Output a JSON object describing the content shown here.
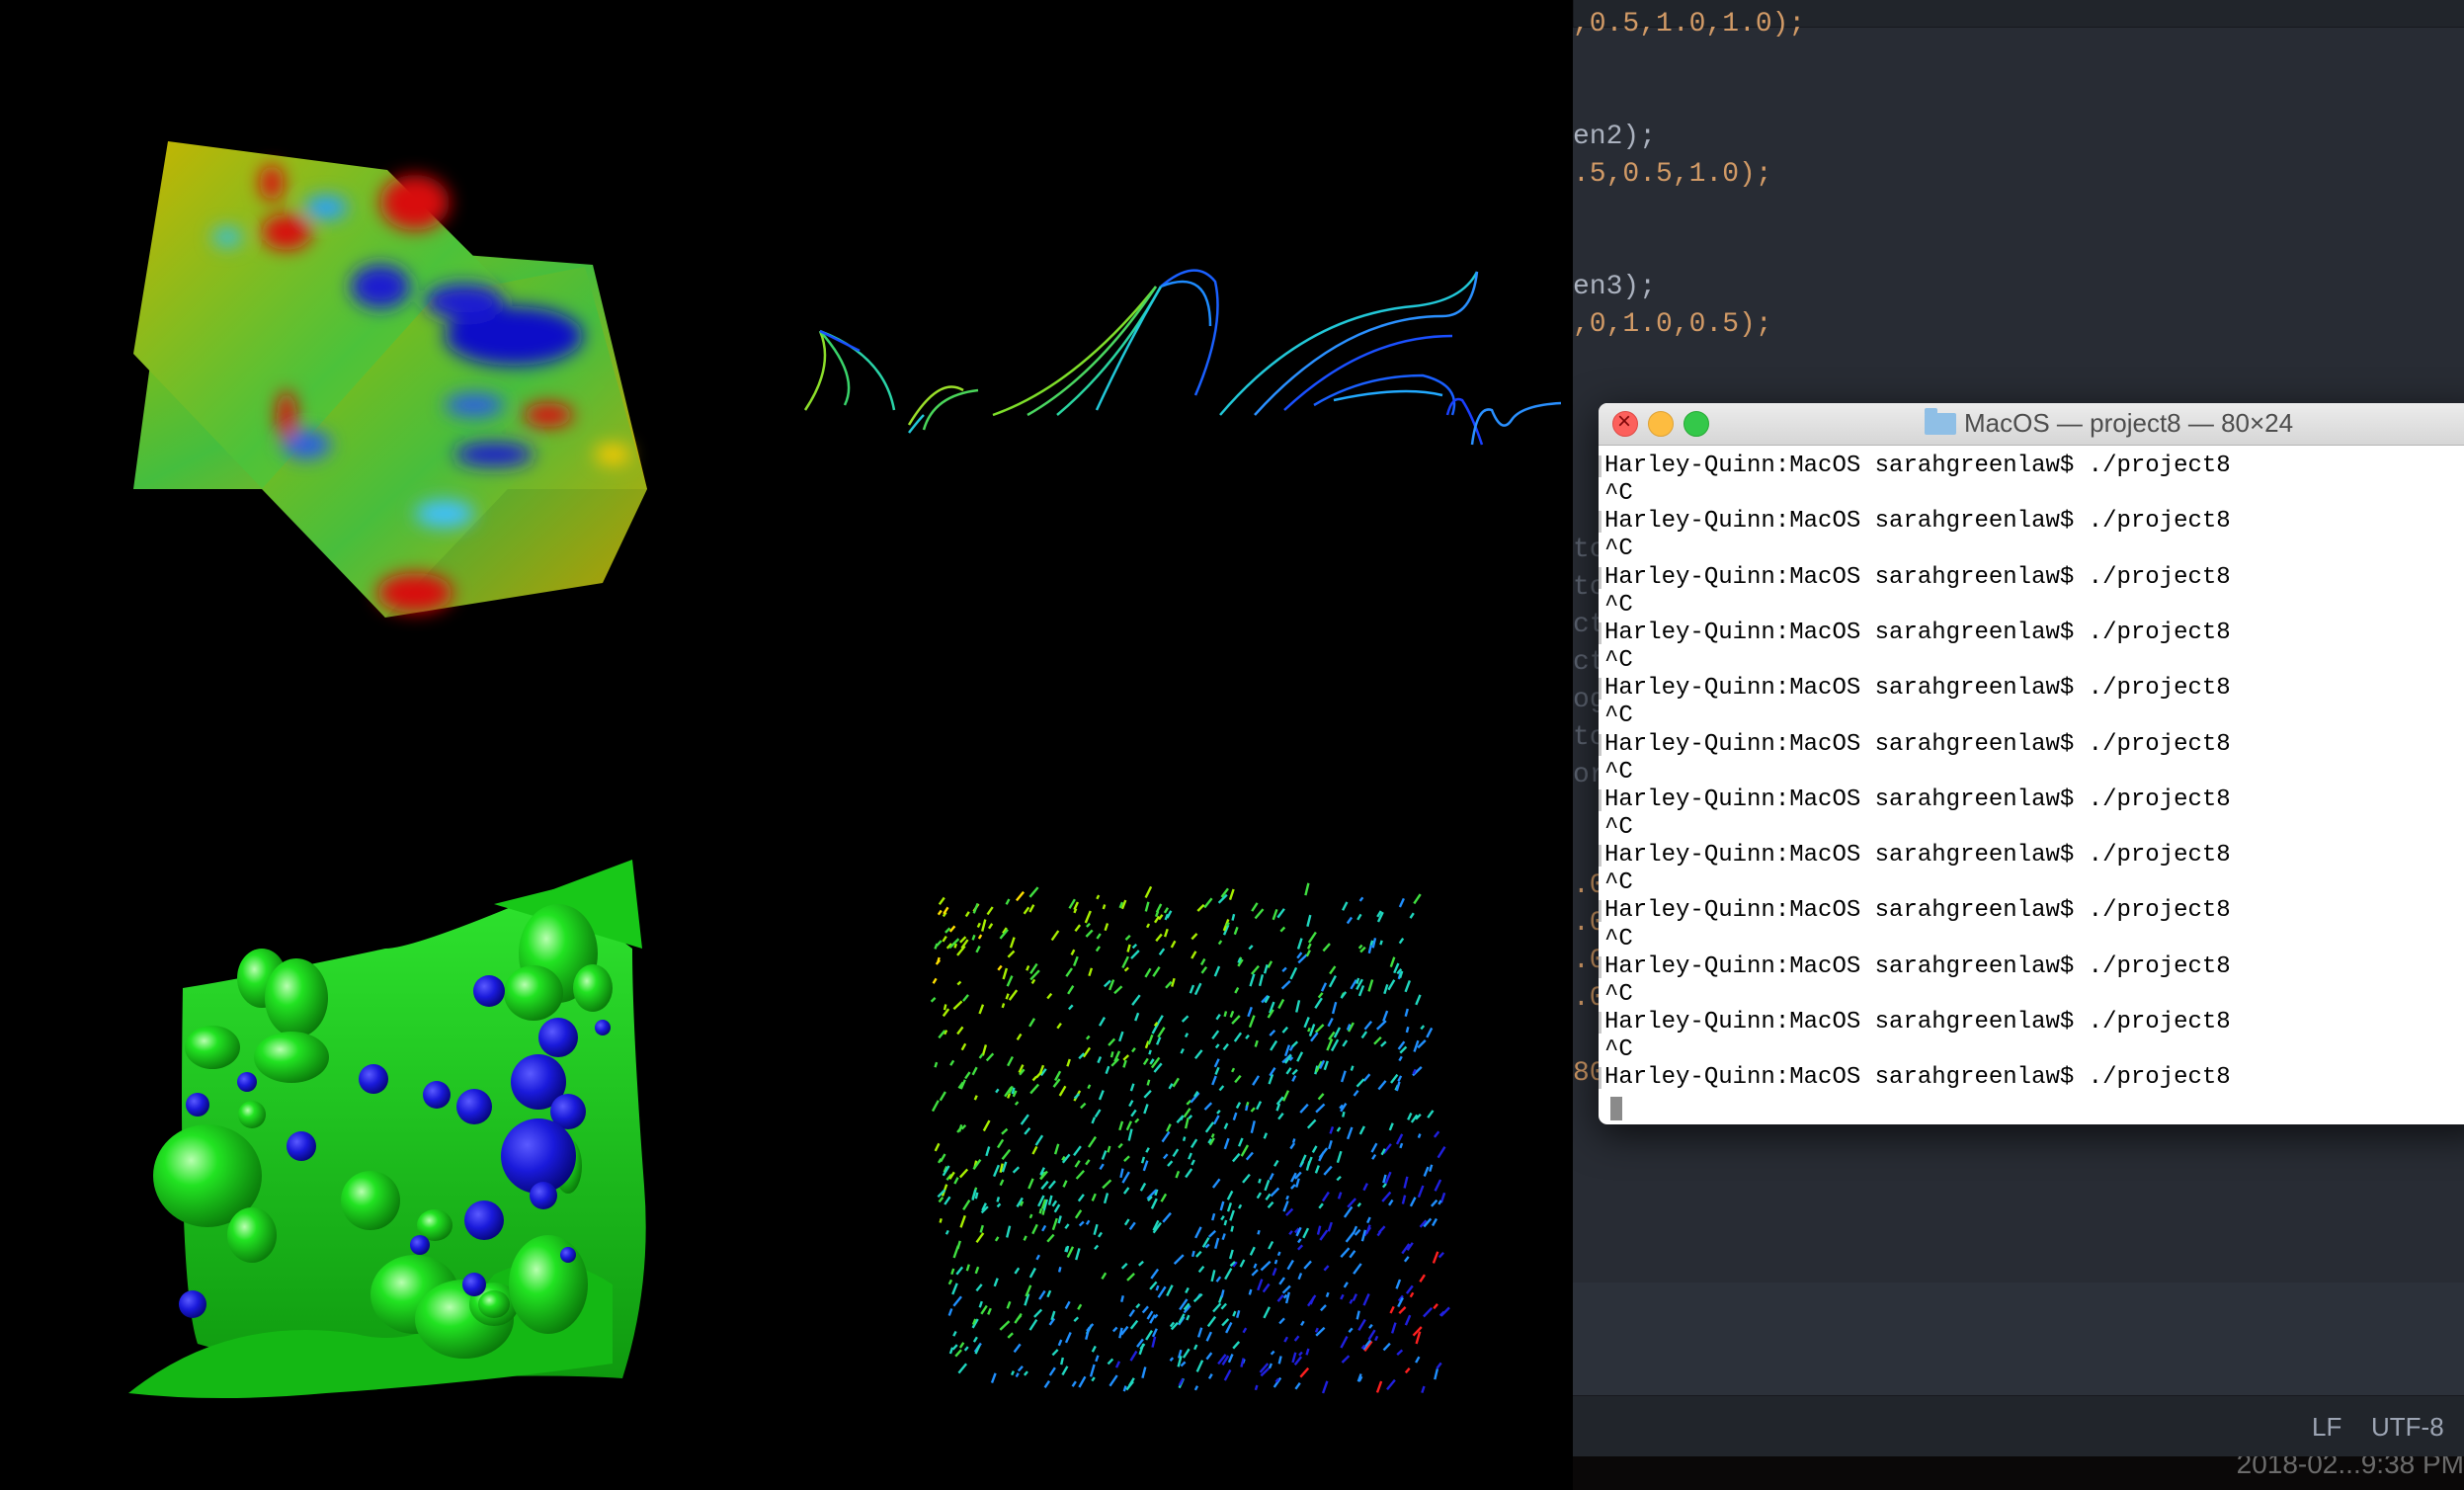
{
  "gl_window": {
    "panels": [
      "colored-surface-planes",
      "streamlines",
      "isosurface-blobs",
      "vector-glyph-field"
    ]
  },
  "editor": {
    "code_lines": [
      {
        "text": ",0.5,1.0,1.0);",
        "y": 0
      },
      {
        "text": "en2);",
        "y": 1
      },
      {
        "text": ".5,0.5,1.0);",
        "y": 2
      },
      {
        "text": "en3);",
        "y": 3
      },
      {
        "text": ",0,1.0,0.5);",
        "y": 4
      }
    ],
    "gutter_fragments": [
      "to",
      "to",
      "ct",
      "ct",
      "og",
      "to",
      "or",
      ".0",
      ".0",
      ".0",
      ".0",
      "80"
    ],
    "colors": {
      "background": "#282c34",
      "number": "#d19a66",
      "text": "#abb2bf"
    }
  },
  "statusbar": {
    "line_ending": "LF",
    "encoding": "UTF-8"
  },
  "menubar_clock": "2018-02...9:38 PM",
  "terminal": {
    "title": "MacOS — project8 — 80×24",
    "prompt": "Harley-Quinn:MacOS sarahgreenlaw$ ./project8",
    "interrupt": "^C",
    "lines": [
      "Harley-Quinn:MacOS sarahgreenlaw$ ./project8",
      "^C",
      "Harley-Quinn:MacOS sarahgreenlaw$ ./project8",
      "^C",
      "Harley-Quinn:MacOS sarahgreenlaw$ ./project8",
      "^C",
      "Harley-Quinn:MacOS sarahgreenlaw$ ./project8",
      "^C",
      "Harley-Quinn:MacOS sarahgreenlaw$ ./project8",
      "^C",
      "Harley-Quinn:MacOS sarahgreenlaw$ ./project8",
      "^C",
      "Harley-Quinn:MacOS sarahgreenlaw$ ./project8",
      "^C",
      "Harley-Quinn:MacOS sarahgreenlaw$ ./project8",
      "^C",
      "Harley-Quinn:MacOS sarahgreenlaw$ ./project8",
      "^C",
      "Harley-Quinn:MacOS sarahgreenlaw$ ./project8",
      "^C",
      "Harley-Quinn:MacOS sarahgreenlaw$ ./project8",
      "^C",
      "Harley-Quinn:MacOS sarahgreenlaw$ ./project8"
    ],
    "colors": {
      "close": "#fc605c",
      "minimize": "#fdbc40",
      "maximize": "#34c84a"
    }
  }
}
